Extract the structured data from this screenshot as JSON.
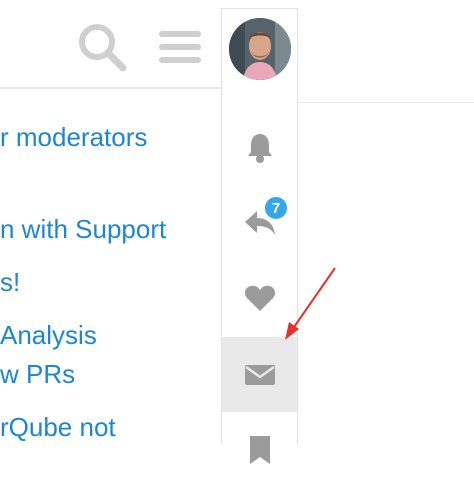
{
  "header": {
    "search_icon": "search-icon",
    "menu_icon": "hamburger-icon",
    "avatar_alt": "User avatar"
  },
  "topics": [
    {
      "text": "r moderators"
    },
    {
      "text": "n with Support"
    },
    {
      "text": "s!"
    },
    {
      "text": "Analysis"
    },
    {
      "text": "w PRs"
    },
    {
      "text": "rQube not"
    }
  ],
  "user_menu": {
    "items": [
      {
        "icon": "bell-icon"
      },
      {
        "icon": "reply-icon",
        "badge": "7"
      },
      {
        "icon": "heart-icon"
      },
      {
        "icon": "envelope-icon",
        "active": true
      },
      {
        "icon": "bookmark-icon"
      }
    ]
  },
  "colors": {
    "link": "#1d86d2",
    "icon_gray": "#9b9b9b",
    "badge": "#33a7e8",
    "annotation_arrow": "#e8312a",
    "active_bg": "#e9e9e9"
  }
}
